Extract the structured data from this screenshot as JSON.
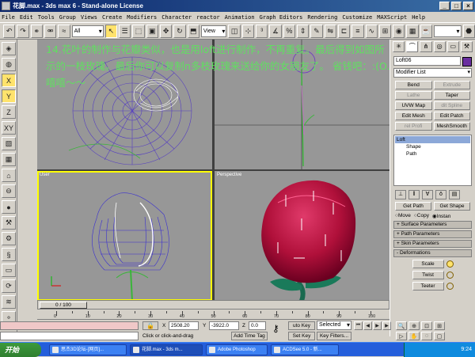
{
  "window": {
    "title": "花脚.max - 3ds max 6 - Stand-alone License"
  },
  "menu": [
    "File",
    "Edit",
    "Tools",
    "Group",
    "Views",
    "Create",
    "Modifiers",
    "Character",
    "reactor",
    "Animation",
    "Graph Editors",
    "Rendering",
    "Customize",
    "MAXScript",
    "Help"
  ],
  "toolbar": {
    "selection_filter": "All",
    "ref_coord": "View"
  },
  "left_tools": [
    "X",
    "Y",
    "Z",
    "XY"
  ],
  "viewports": {
    "top_left": "",
    "top_right": "",
    "bottom_left": "User",
    "bottom_right": "Perspective"
  },
  "overlay_note": "14.花叶的制作与花瓣类似，也是用loft进行制作，不再重复。最后得到如图所示的一枝玫瑰。最后你可以复制n多枝玫瑰来送给你的女朋友了。 省钱吧：:(O.嘻嘻～～",
  "command_panel": {
    "object_name": "Loft06",
    "swatch_color": "#6a2fa0",
    "modifier_list": "Modifier List",
    "modifier_buttons": [
      {
        "label": "Bend",
        "enabled": true
      },
      {
        "label": "Extrude",
        "enabled": false
      },
      {
        "label": "Lathe",
        "enabled": false
      },
      {
        "label": "Taper",
        "enabled": true
      },
      {
        "label": "UVW Map",
        "enabled": true
      },
      {
        "label": "dit Spline",
        "enabled": false
      },
      {
        "label": "Edit Mesh",
        "enabled": true
      },
      {
        "label": "Edit Patch",
        "enabled": true
      },
      {
        "label": "rel Profi",
        "enabled": false
      },
      {
        "label": "MeshSmooth",
        "enabled": true
      }
    ],
    "stack": [
      {
        "label": "Loft",
        "selected": true,
        "sub": false
      },
      {
        "label": "Shape",
        "selected": false,
        "sub": true
      },
      {
        "label": "Path",
        "selected": false,
        "sub": true
      }
    ],
    "get_path": "Get Path",
    "get_shape": "Get Shape",
    "radio_move": "Move",
    "radio_copy": "Copy",
    "radio_instance": "Instan",
    "rollouts": [
      "Surface Parameters",
      "Path Parameters",
      "Skin Parameters"
    ],
    "deformations_title": "Deformations",
    "deformations": [
      {
        "label": "Scale",
        "on": true
      },
      {
        "label": "Twist",
        "on": false
      },
      {
        "label": "Teeter",
        "on": false
      }
    ]
  },
  "timeline": {
    "position": "0 / 100",
    "ticks": [
      "0",
      "10",
      "20",
      "30",
      "40",
      "50",
      "60",
      "70",
      "80",
      "90",
      "100"
    ]
  },
  "status": {
    "prompt": "Click or click-and-drag",
    "add_time_tag": "Add Time Tag",
    "x_label": "X",
    "x_value": "2508.20",
    "y_label": "Y",
    "y_value": "-3922.0",
    "z_label": "Z",
    "z_value": "0.0",
    "auto_key": "uto Key",
    "set_key": "Set Key",
    "key_mode": "Selected",
    "key_filters": "Key Filters..."
  },
  "taskbar": {
    "start": "开始",
    "tasks": [
      "思杰3D论坛-[网页]...",
      "花脚.max - 3ds m...",
      "Adobe Photoshop",
      "ACDSee 5.0 - 新..."
    ],
    "clock": "9:24"
  },
  "colors": {
    "accent": "#ffff00",
    "note": "#60e060",
    "viewport": "#979797",
    "title": "#0a246a"
  }
}
